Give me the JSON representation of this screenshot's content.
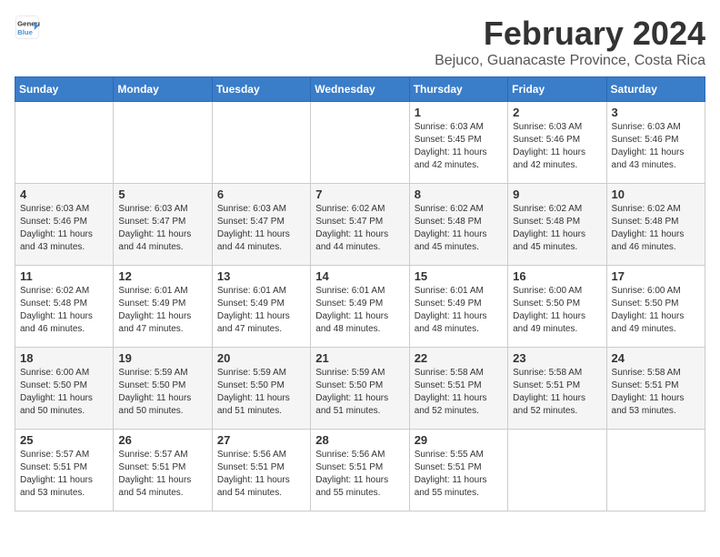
{
  "header": {
    "logo_line1": "General",
    "logo_line2": "Blue",
    "title": "February 2024",
    "subtitle": "Bejuco, Guanacaste Province, Costa Rica"
  },
  "weekdays": [
    "Sunday",
    "Monday",
    "Tuesday",
    "Wednesday",
    "Thursday",
    "Friday",
    "Saturday"
  ],
  "weeks": [
    [
      {
        "day": "",
        "sunrise": "",
        "sunset": "",
        "daylight": ""
      },
      {
        "day": "",
        "sunrise": "",
        "sunset": "",
        "daylight": ""
      },
      {
        "day": "",
        "sunrise": "",
        "sunset": "",
        "daylight": ""
      },
      {
        "day": "",
        "sunrise": "",
        "sunset": "",
        "daylight": ""
      },
      {
        "day": "1",
        "sunrise": "Sunrise: 6:03 AM",
        "sunset": "Sunset: 5:45 PM",
        "daylight": "Daylight: 11 hours and 42 minutes."
      },
      {
        "day": "2",
        "sunrise": "Sunrise: 6:03 AM",
        "sunset": "Sunset: 5:46 PM",
        "daylight": "Daylight: 11 hours and 42 minutes."
      },
      {
        "day": "3",
        "sunrise": "Sunrise: 6:03 AM",
        "sunset": "Sunset: 5:46 PM",
        "daylight": "Daylight: 11 hours and 43 minutes."
      }
    ],
    [
      {
        "day": "4",
        "sunrise": "Sunrise: 6:03 AM",
        "sunset": "Sunset: 5:46 PM",
        "daylight": "Daylight: 11 hours and 43 minutes."
      },
      {
        "day": "5",
        "sunrise": "Sunrise: 6:03 AM",
        "sunset": "Sunset: 5:47 PM",
        "daylight": "Daylight: 11 hours and 44 minutes."
      },
      {
        "day": "6",
        "sunrise": "Sunrise: 6:03 AM",
        "sunset": "Sunset: 5:47 PM",
        "daylight": "Daylight: 11 hours and 44 minutes."
      },
      {
        "day": "7",
        "sunrise": "Sunrise: 6:02 AM",
        "sunset": "Sunset: 5:47 PM",
        "daylight": "Daylight: 11 hours and 44 minutes."
      },
      {
        "day": "8",
        "sunrise": "Sunrise: 6:02 AM",
        "sunset": "Sunset: 5:48 PM",
        "daylight": "Daylight: 11 hours and 45 minutes."
      },
      {
        "day": "9",
        "sunrise": "Sunrise: 6:02 AM",
        "sunset": "Sunset: 5:48 PM",
        "daylight": "Daylight: 11 hours and 45 minutes."
      },
      {
        "day": "10",
        "sunrise": "Sunrise: 6:02 AM",
        "sunset": "Sunset: 5:48 PM",
        "daylight": "Daylight: 11 hours and 46 minutes."
      }
    ],
    [
      {
        "day": "11",
        "sunrise": "Sunrise: 6:02 AM",
        "sunset": "Sunset: 5:48 PM",
        "daylight": "Daylight: 11 hours and 46 minutes."
      },
      {
        "day": "12",
        "sunrise": "Sunrise: 6:01 AM",
        "sunset": "Sunset: 5:49 PM",
        "daylight": "Daylight: 11 hours and 47 minutes."
      },
      {
        "day": "13",
        "sunrise": "Sunrise: 6:01 AM",
        "sunset": "Sunset: 5:49 PM",
        "daylight": "Daylight: 11 hours and 47 minutes."
      },
      {
        "day": "14",
        "sunrise": "Sunrise: 6:01 AM",
        "sunset": "Sunset: 5:49 PM",
        "daylight": "Daylight: 11 hours and 48 minutes."
      },
      {
        "day": "15",
        "sunrise": "Sunrise: 6:01 AM",
        "sunset": "Sunset: 5:49 PM",
        "daylight": "Daylight: 11 hours and 48 minutes."
      },
      {
        "day": "16",
        "sunrise": "Sunrise: 6:00 AM",
        "sunset": "Sunset: 5:50 PM",
        "daylight": "Daylight: 11 hours and 49 minutes."
      },
      {
        "day": "17",
        "sunrise": "Sunrise: 6:00 AM",
        "sunset": "Sunset: 5:50 PM",
        "daylight": "Daylight: 11 hours and 49 minutes."
      }
    ],
    [
      {
        "day": "18",
        "sunrise": "Sunrise: 6:00 AM",
        "sunset": "Sunset: 5:50 PM",
        "daylight": "Daylight: 11 hours and 50 minutes."
      },
      {
        "day": "19",
        "sunrise": "Sunrise: 5:59 AM",
        "sunset": "Sunset: 5:50 PM",
        "daylight": "Daylight: 11 hours and 50 minutes."
      },
      {
        "day": "20",
        "sunrise": "Sunrise: 5:59 AM",
        "sunset": "Sunset: 5:50 PM",
        "daylight": "Daylight: 11 hours and 51 minutes."
      },
      {
        "day": "21",
        "sunrise": "Sunrise: 5:59 AM",
        "sunset": "Sunset: 5:50 PM",
        "daylight": "Daylight: 11 hours and 51 minutes."
      },
      {
        "day": "22",
        "sunrise": "Sunrise: 5:58 AM",
        "sunset": "Sunset: 5:51 PM",
        "daylight": "Daylight: 11 hours and 52 minutes."
      },
      {
        "day": "23",
        "sunrise": "Sunrise: 5:58 AM",
        "sunset": "Sunset: 5:51 PM",
        "daylight": "Daylight: 11 hours and 52 minutes."
      },
      {
        "day": "24",
        "sunrise": "Sunrise: 5:58 AM",
        "sunset": "Sunset: 5:51 PM",
        "daylight": "Daylight: 11 hours and 53 minutes."
      }
    ],
    [
      {
        "day": "25",
        "sunrise": "Sunrise: 5:57 AM",
        "sunset": "Sunset: 5:51 PM",
        "daylight": "Daylight: 11 hours and 53 minutes."
      },
      {
        "day": "26",
        "sunrise": "Sunrise: 5:57 AM",
        "sunset": "Sunset: 5:51 PM",
        "daylight": "Daylight: 11 hours and 54 minutes."
      },
      {
        "day": "27",
        "sunrise": "Sunrise: 5:56 AM",
        "sunset": "Sunset: 5:51 PM",
        "daylight": "Daylight: 11 hours and 54 minutes."
      },
      {
        "day": "28",
        "sunrise": "Sunrise: 5:56 AM",
        "sunset": "Sunset: 5:51 PM",
        "daylight": "Daylight: 11 hours and 55 minutes."
      },
      {
        "day": "29",
        "sunrise": "Sunrise: 5:55 AM",
        "sunset": "Sunset: 5:51 PM",
        "daylight": "Daylight: 11 hours and 55 minutes."
      },
      {
        "day": "",
        "sunrise": "",
        "sunset": "",
        "daylight": ""
      },
      {
        "day": "",
        "sunrise": "",
        "sunset": "",
        "daylight": ""
      }
    ]
  ]
}
